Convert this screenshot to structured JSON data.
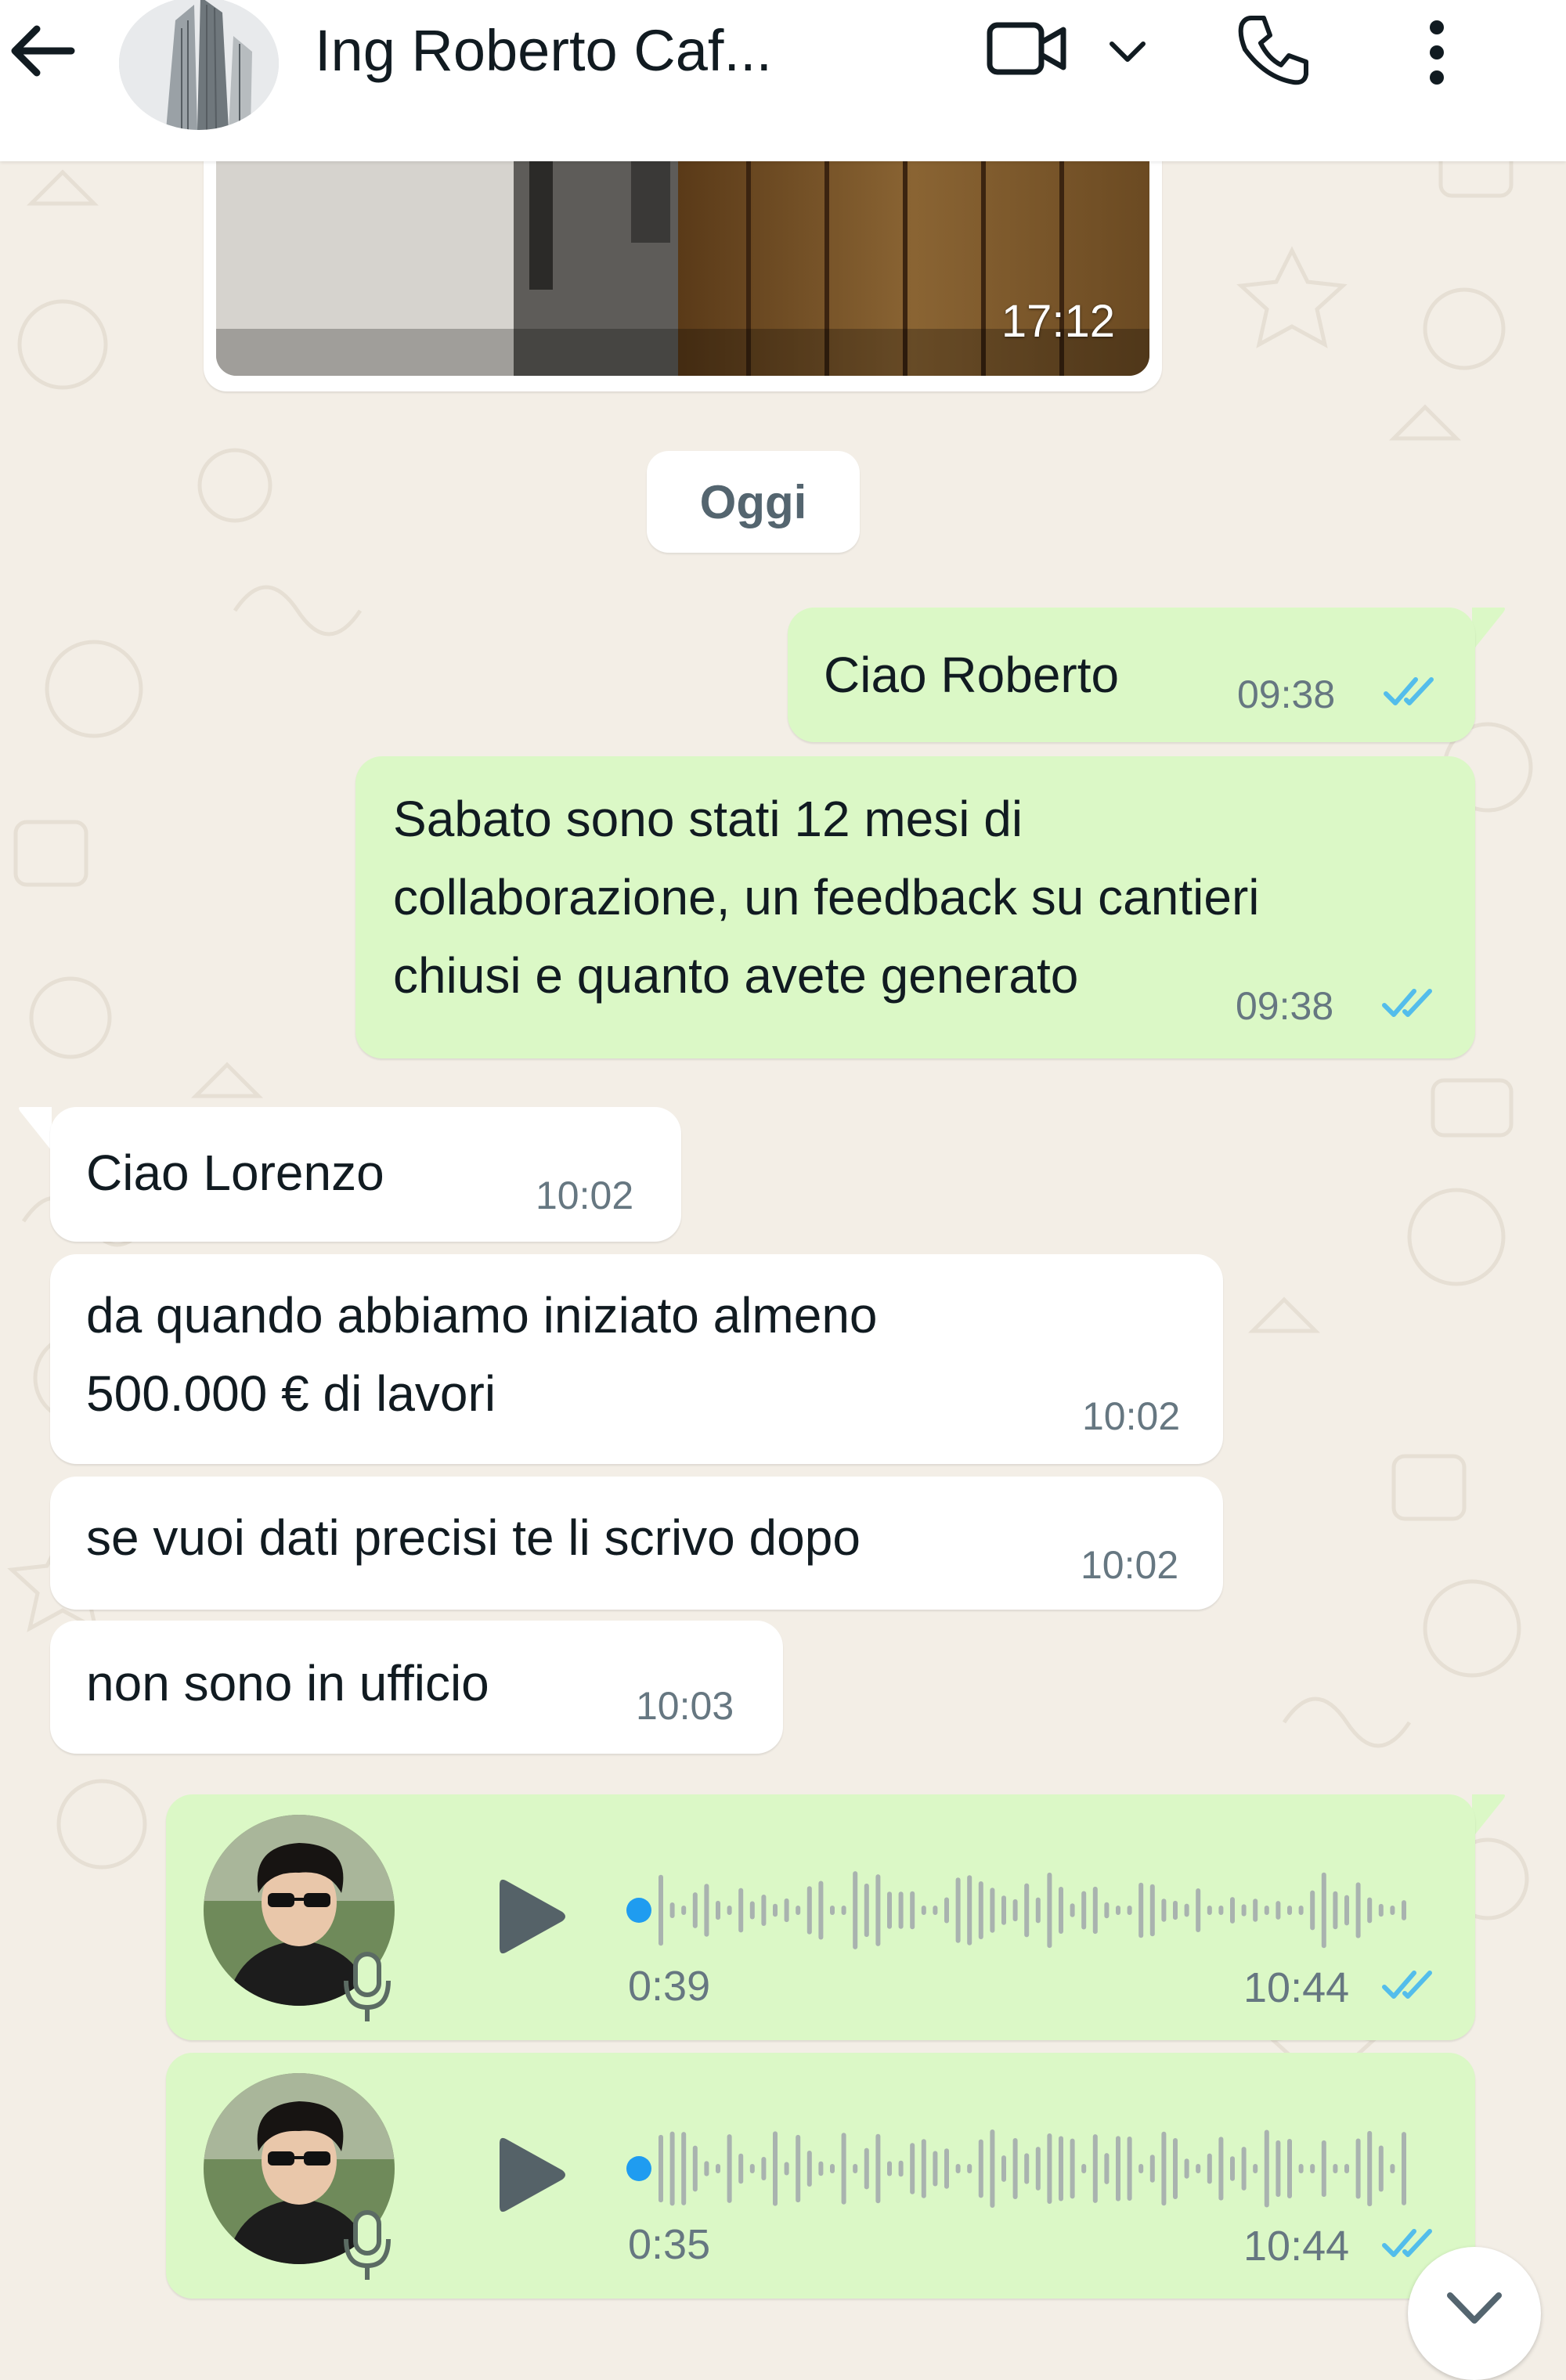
{
  "header": {
    "contact_name": "Ing Roberto Caf...",
    "icons": {
      "back": "back-arrow-icon",
      "video": "video-call-icon",
      "caret": "chevron-down-icon",
      "call": "phone-icon",
      "menu": "more-vertical-icon"
    }
  },
  "messages": {
    "image": {
      "time": "17:12"
    },
    "date_divider": "Oggi",
    "out1": {
      "text": "Ciao Roberto",
      "time": "09:38"
    },
    "out2": {
      "lines": [
        "Sabato sono stati 12 mesi di",
        "collaborazione, un feedback su cantieri",
        "chiusi e quanto avete generato"
      ],
      "time": "09:38"
    },
    "in1": {
      "text": "Ciao Lorenzo",
      "time": "10:02"
    },
    "in2": {
      "lines": [
        "da quando abbiamo iniziato almeno",
        "500.000 € di lavori"
      ],
      "time": "10:02"
    },
    "in3": {
      "text": "se vuoi dati precisi te li scrivo dopo",
      "time": "10:02"
    },
    "in4": {
      "text": "non sono in ufficio",
      "time": "10:03"
    },
    "voice1": {
      "duration": "0:39",
      "time": "10:44",
      "progress": 0
    },
    "voice2": {
      "duration": "0:35",
      "time": "10:44",
      "progress": 0
    }
  },
  "colors": {
    "outgoing_bubble": "#dbf8c6",
    "incoming_bubble": "#ffffff",
    "chat_background": "#f3eee6",
    "read_ticks": "#53bdeb",
    "voice_progress_dot": "#1f9cf0"
  }
}
